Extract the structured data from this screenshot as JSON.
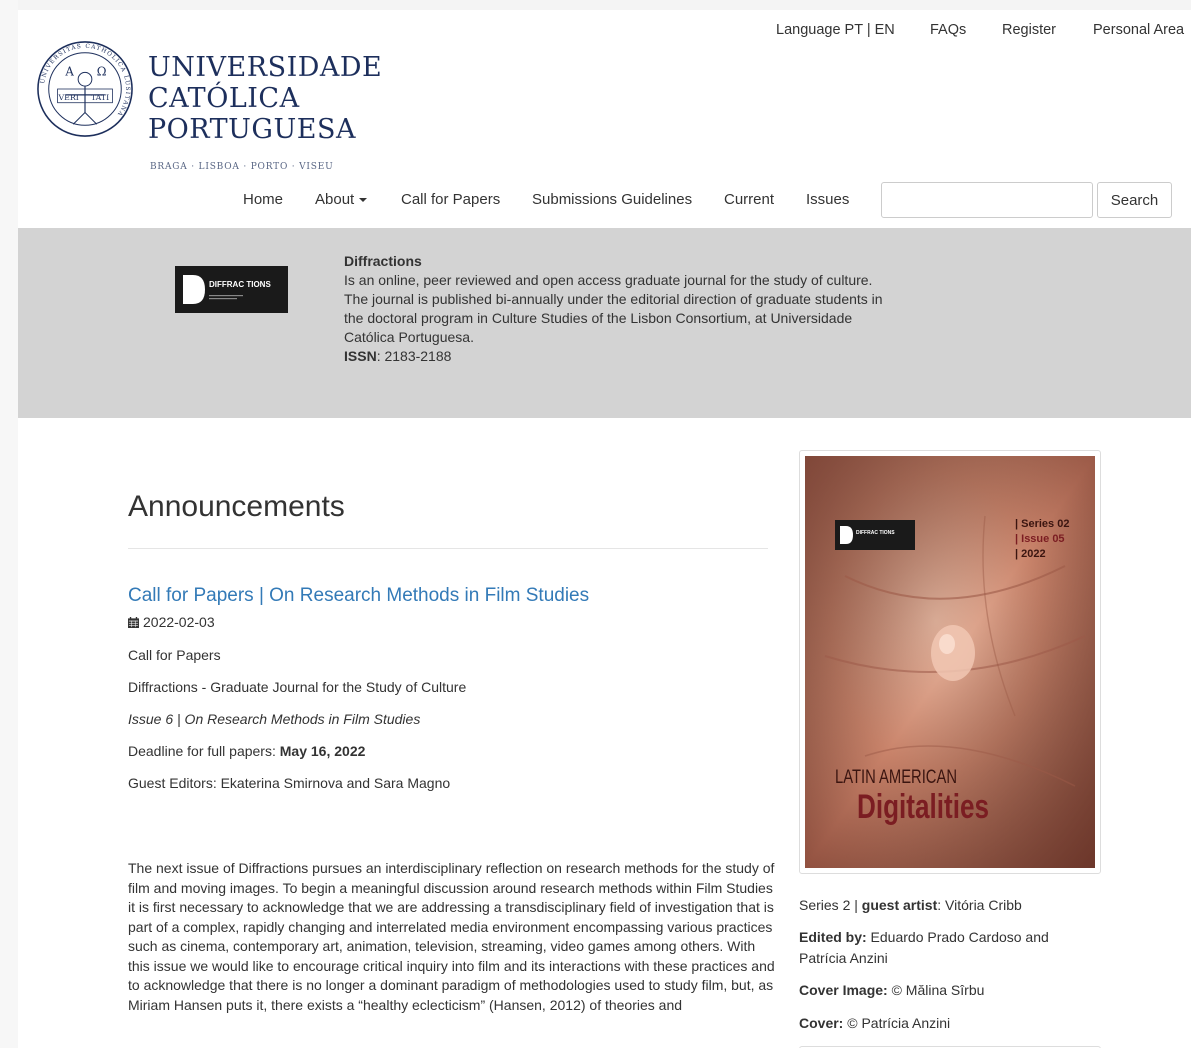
{
  "header": {
    "utility_links": {
      "language": "Language PT | EN",
      "faqs": "FAQs",
      "register": "Register",
      "personal_area": "Personal Area"
    },
    "university_name": [
      "UNIVERSIDADE",
      "CATÓLICA",
      "PORTUGUESA"
    ],
    "cities": "BRAGA · LISBOA · PORTO · VISEU",
    "seal_texts": {
      "motto_left": "VERI",
      "motto_right": "TATI",
      "alpha": "A",
      "omega": "Ω",
      "ring": "UNIVERSITAS CATHOLICA LUSITANA"
    }
  },
  "nav": {
    "items": [
      "Home",
      "About",
      "Call for Papers",
      "Submissions Guidelines",
      "Current",
      "Issues"
    ],
    "search_value": "",
    "search_button": "Search"
  },
  "journal": {
    "logo_text": "DIFFRAC TIONS",
    "title": "Diffractions",
    "description": "Is an online, peer reviewed and open access graduate journal for the study of culture. The journal is published bi-annually under the editorial direction of graduate students in the doctoral program in Culture Studies of the Lisbon Consortium, at Universidade Católica Portuguesa.",
    "issn_label": "ISSN",
    "issn_value": ": 2183-2188"
  },
  "announcements": {
    "heading": "Announcements",
    "item": {
      "title": "Call for Papers | On Research Methods in Film Studies",
      "date": "2022-02-03",
      "category": "Call for Papers",
      "journal_line": "Diffractions - Graduate Journal for the Study of Culture",
      "issue_line": "Issue 6 | On Research Methods in Film Studies",
      "deadline_label": "Deadline for full papers: ",
      "deadline_value": "May 16, 2022",
      "editors": "Guest Editors: Ekaterina Smirnova and Sara Magno",
      "body": "The next issue of Diffractions pursues an interdisciplinary reflection on research methods for the study of film and moving images. To begin a meaningful discussion around research methods within Film Studies it is first necessary to acknowledge that we are addressing a transdisciplinary field of investigation that is part of a complex, rapidly changing and interrelated media environment encompassing various practices such as cinema, contemporary art, animation, television, streaming, video games among others. With this issue we would like to encourage critical inquiry into film and its interactions with these practices and to acknowledge that there is no longer a dominant paradigm of methodologies used to study film, but, as Miriam Hansen puts it, there exists a “healthy eclecticism” (Hansen, 2012) of theories and"
    }
  },
  "sidebar": {
    "cover": {
      "series": "| Series 02",
      "issue": "| Issue 05",
      "year": "| 2022",
      "line1": "LATIN AMERICAN",
      "line2": "Digitalities"
    },
    "series_prefix": "Series 2 | ",
    "guest_artist_label": "guest artist",
    "guest_artist_value": ": Vitória Cribb",
    "edited_by_label": "Edited by:",
    "edited_by_value": " Eduardo Prado Cardoso and Patrícia Anzini",
    "cover_image_label": "Cover Image:",
    "cover_image_value": " © Mălina Sîrbu",
    "cover_label": "Cover:",
    "cover_value": " © Patrícia Anzini"
  },
  "colors": {
    "link": "#337ab7",
    "banner_bg": "#d3d3d3",
    "wordmark": "#1d2f5c",
    "cover_title": "#7b1d22"
  },
  "icons": [
    "calendar-icon",
    "caret-down-icon",
    "university-seal",
    "diffractions-logo"
  ]
}
